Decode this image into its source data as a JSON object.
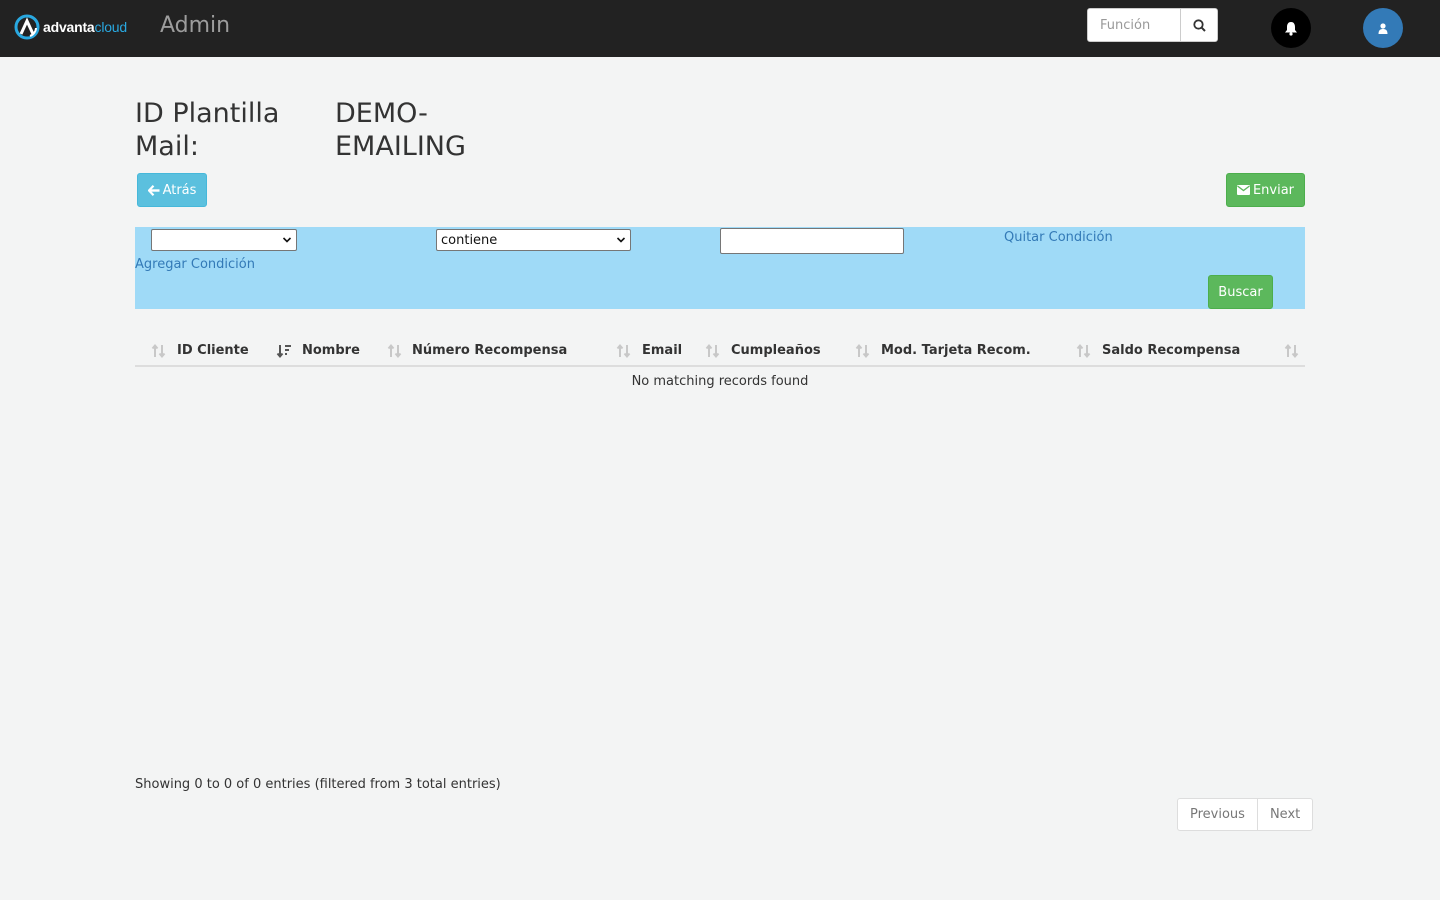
{
  "navbar": {
    "brand_part1": "advanta",
    "brand_part2": "cloud",
    "title": "Admin",
    "search_placeholder": "Función",
    "icons": [
      "logo-icon",
      "search-icon",
      "bell-icon",
      "user-icon"
    ],
    "colors": {
      "bar": "#222222",
      "brand_accent": "#29a8e0",
      "user_button": "#337ab7"
    }
  },
  "heading": {
    "label": "ID Plantilla Mail:",
    "value": "DEMO-EMAILING"
  },
  "actions": {
    "back_label": "Atrás",
    "send_label": "Enviar"
  },
  "filter": {
    "field_selected": "",
    "operator_selected": "contiene",
    "value_text": "",
    "remove_label": "Quitar Condición",
    "add_label": "Agregar Condición",
    "search_label": "Buscar",
    "background": "#9fdaf7"
  },
  "table": {
    "columns": [
      "ID Cliente",
      "Nombre",
      "Número Recompensa",
      "Email",
      "Cumpleaños",
      "Mod. Tarjeta Recom.",
      "Saldo Recompensa"
    ],
    "empty_message": "No matching records found",
    "info": "Showing 0 to 0 of 0 entries (filtered from 3 total entries)"
  },
  "pagination": {
    "previous": "Previous",
    "next": "Next"
  }
}
